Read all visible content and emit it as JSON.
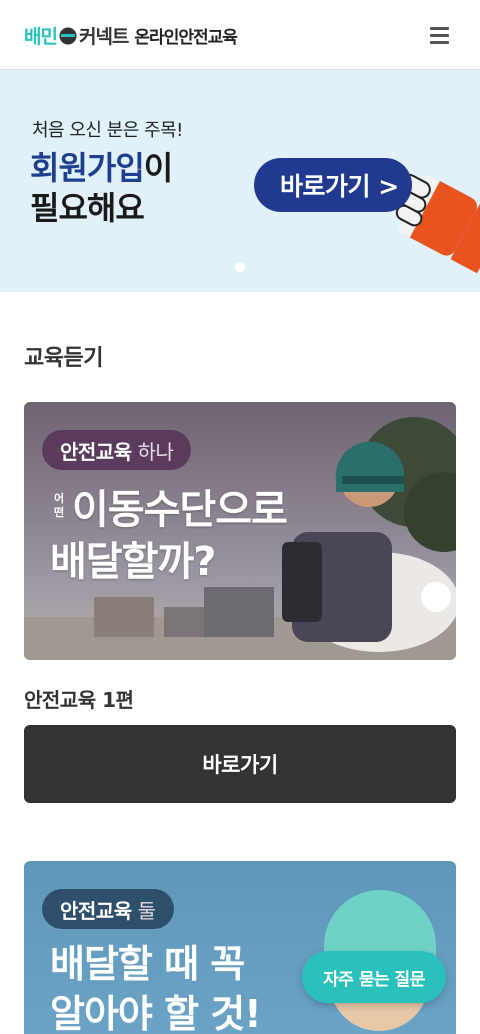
{
  "header": {
    "logo_part1": "배민",
    "logo_part2": "커넥트",
    "logo_part3": "온라인안전교육",
    "menu_icon": "hamburger-menu-icon"
  },
  "banner": {
    "small_text": "처음 오신 분은 주목!",
    "title_highlight": "회원가입",
    "title_rest_line1": "이",
    "title_line2": "필요해요",
    "button_label": "바로가기 >",
    "bg_color": "#e0f1fa",
    "button_color": "#1f3a8f",
    "slide_count": 1,
    "active_slide": 1
  },
  "section": {
    "title": "교육듣기"
  },
  "course1": {
    "tag_bold": "안전교육",
    "tag_light": "하나",
    "small_vertical": "어떤",
    "title_line1": "이동수단으로",
    "title_line2": "배달할까?",
    "caption": "안전교육 1편",
    "button_label": "바로가기"
  },
  "course2": {
    "tag_bold": "안전교육",
    "tag_light": "둘",
    "title_line1": "배달할 때 꼭",
    "title_line2": "알아야 할 것!"
  },
  "faq": {
    "button_label": "자주 묻는 질문",
    "color": "#2ac1bc"
  }
}
